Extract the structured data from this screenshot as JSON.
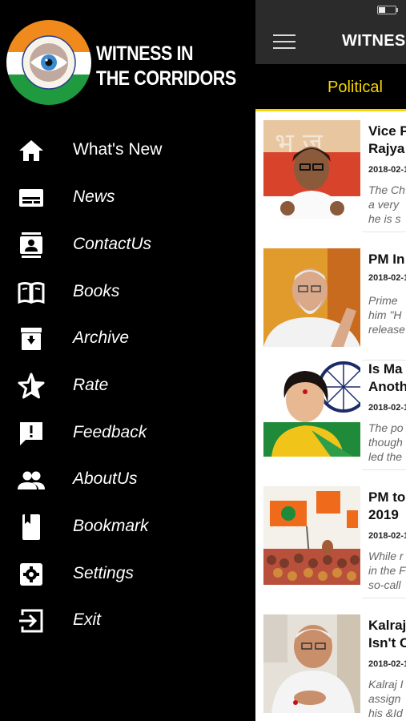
{
  "app": {
    "title": "WITNESS IN THE CORRIDORS",
    "title_visible": "WITNES",
    "active_tab": "Political",
    "accent_color": "#f5d600"
  },
  "drawer": {
    "logo": {
      "line1": "WITNESS IN",
      "line2": "THE CORRIDORS"
    },
    "items": [
      {
        "label": "What's New",
        "icon": "home-icon"
      },
      {
        "label": "News",
        "icon": "news-icon"
      },
      {
        "label": "ContactUs",
        "icon": "contact-icon"
      },
      {
        "label": "Books",
        "icon": "book-open-icon"
      },
      {
        "label": "Archive",
        "icon": "archive-icon"
      },
      {
        "label": "Rate",
        "icon": "star-icon"
      },
      {
        "label": "Feedback",
        "icon": "feedback-icon"
      },
      {
        "label": "AboutUs",
        "icon": "people-icon"
      },
      {
        "label": "Bookmark",
        "icon": "bookmark-icon"
      },
      {
        "label": "Settings",
        "icon": "gear-icon"
      },
      {
        "label": "Exit",
        "icon": "exit-icon"
      }
    ]
  },
  "articles": [
    {
      "title_l1": "Vice P",
      "title_l2": "Rajya",
      "date": "2018-02-1",
      "ex1": "The Ch",
      "ex2": "a very",
      "ex3": "he is s"
    },
    {
      "title_l1": "PM In",
      "title_l2": "",
      "date": "2018-02-1",
      "ex1": "Prime",
      "ex2": "him \"H",
      "ex3": "release"
    },
    {
      "title_l1": "Is Ma",
      "title_l2": "Anoth",
      "date": "2018-02-1",
      "ex1": "The po",
      "ex2": "though",
      "ex3": "led the"
    },
    {
      "title_l1": "PM to",
      "title_l2": "2019",
      "date": "2018-02-1",
      "ex1": "While r",
      "ex2": "in the F",
      "ex3": "so-call"
    },
    {
      "title_l1": "Kalraj",
      "title_l2": "Isn't C",
      "date": "2018-02-1",
      "ex1": "Kalraj I",
      "ex2": "assign",
      "ex3": "his &Id"
    }
  ]
}
